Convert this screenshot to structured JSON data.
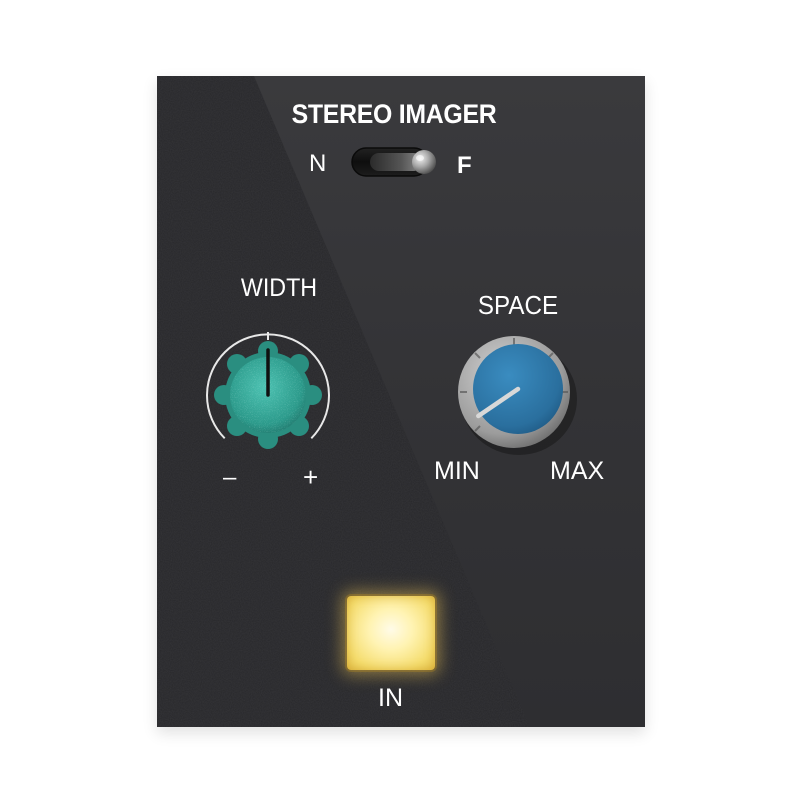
{
  "panel": {
    "title": "STEREO IMAGER",
    "toggle": {
      "left_label": "N",
      "right_label": "F",
      "state": "F",
      "icon": "toggle-switch-icon"
    },
    "width_knob": {
      "label": "WIDTH",
      "min_label": "–",
      "max_label": "+",
      "position_fraction": 0.5,
      "color": "#34a496"
    },
    "space_knob": {
      "label": "SPACE",
      "min_label": "MIN",
      "max_label": "MAX",
      "position_fraction": 0.04,
      "color": "#2f78a8"
    },
    "in_button": {
      "label": "IN",
      "lit": true,
      "color": "#f7e27a"
    },
    "colors": {
      "panel_dark": "#29292b",
      "panel_light": "#353538",
      "text": "#ffffff"
    }
  }
}
